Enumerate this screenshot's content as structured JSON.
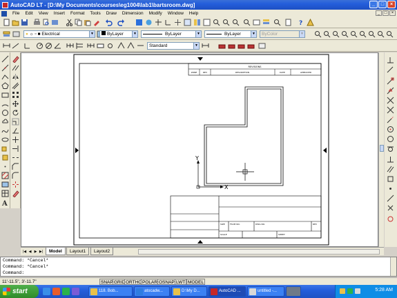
{
  "window": {
    "title": "AutoCAD LT - [D:\\My Documents\\courses\\eg1004\\lab1\\bartsroom.dwg]",
    "minimize": "_",
    "maximize": "□",
    "close": "×"
  },
  "menu": {
    "items": [
      "File",
      "Edit",
      "View",
      "Insert",
      "Format",
      "Tools",
      "Draw",
      "Dimension",
      "Modify",
      "Window",
      "Help"
    ],
    "doc_minimize": "_",
    "doc_restore": "□",
    "doc_close": "×"
  },
  "properties": {
    "layer": "Electrical",
    "color": "ByLayer",
    "linetype": "ByLayer",
    "lineweight": "ByLayer",
    "plotstyle": "ByColor"
  },
  "styles": {
    "dim_style": "Standard"
  },
  "drawing": {
    "revisions_title": "REVISIONS",
    "rev_headers": [
      "ZONE",
      "REV",
      "DESCRIPTION",
      "DATE",
      "APPROVED"
    ],
    "size_label": "SIZE",
    "fscm_label": "FSCM NO.",
    "dwg_label": "DWG NO.",
    "rev_label": "REV",
    "scale_label": "SCALE",
    "sheet_label": "SHEET",
    "ucs_x": "X",
    "ucs_y": "Y"
  },
  "tabs": {
    "nav_first": "|◀",
    "nav_prev": "◀",
    "nav_next": "▶",
    "nav_last": "▶|",
    "items": [
      "Model",
      "Layout1",
      "Layout2"
    ]
  },
  "command": {
    "lines": [
      "Command: *Cancel*",
      "Command: *Cancel*",
      "Command:"
    ]
  },
  "status": {
    "coords": "11'-11.5\", 3'-11.7\"",
    "buttons": [
      "SNAP",
      "GRID",
      "ORTHO",
      "POLAR",
      "OSNAP",
      "LWT",
      "MODEL"
    ]
  },
  "taskbar": {
    "start": "start",
    "tasks": [
      "118. Bob...",
      "atocadw...",
      "D:\\My D...",
      "AutoCAD ...",
      "untitled -..."
    ],
    "clock": "5:28 AM"
  },
  "icons": [
    "app-icon",
    "new-icon",
    "open-icon",
    "save-icon",
    "print-icon",
    "cut-icon",
    "copy-icon",
    "paste-icon",
    "undo-icon",
    "redo-icon",
    "pan-icon",
    "zoom-icon",
    "help-icon",
    "layer-icon",
    "line-icon",
    "circle-icon",
    "arc-icon",
    "text-icon",
    "erase-icon",
    "move-icon"
  ]
}
